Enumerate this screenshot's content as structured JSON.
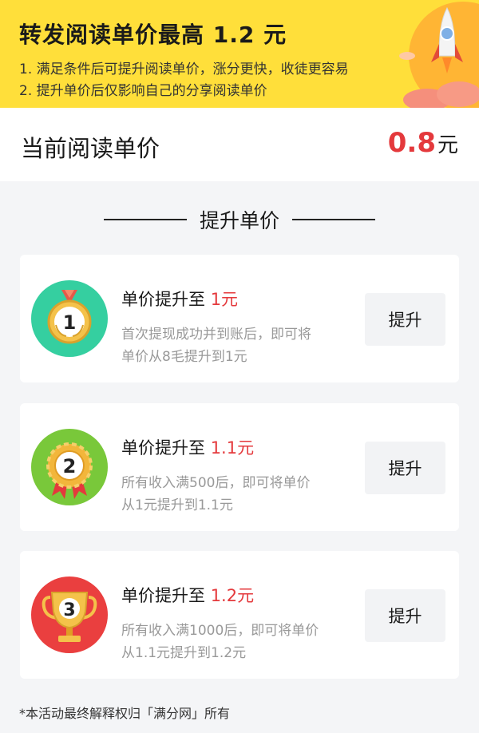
{
  "banner": {
    "title": "转发阅读单价最高 1.2 元",
    "line1": "1.  满足条件后可提升阅读单价，涨分更快，收徒更容易",
    "line2": "2. 提升单价后仅影响自己的分享阅读单价",
    "art_icon": "rocket-icon"
  },
  "current": {
    "label": "当前阅读单价",
    "value": "0.8",
    "unit": "元"
  },
  "section": {
    "heading": "提升单价"
  },
  "cards": [
    {
      "title_prefix": "单价提升至 ",
      "title_value": "1元",
      "desc_line1": "首次提现成功并到账后，即可将",
      "desc_line2": "单价从8毛提升到1元",
      "medal_number": "1",
      "icon": "gold-medal-icon",
      "button_label": "提升"
    },
    {
      "title_prefix": "单价提升至 ",
      "title_value": "1.1元",
      "desc_line1": "所有收入满500后，即可将单价",
      "desc_line2": "从1元提升到1.1元",
      "medal_number": "2",
      "icon": "rosette-medal-icon",
      "button_label": "提升"
    },
    {
      "title_prefix": "单价提升至 ",
      "title_value": "1.2元",
      "desc_line1": "所有收入满1000后，即可将单价",
      "desc_line2": "从1.1元提升到1.2元",
      "medal_number": "3",
      "icon": "trophy-icon",
      "button_label": "提升"
    }
  ],
  "footer": {
    "note": "*本活动最终解释权归「满分网」所有"
  },
  "colors": {
    "banner_bg": "#ffdf3a",
    "accent_red": "#e4393c",
    "medal1_bg": "#35cfa0",
    "medal2_bg": "#79c83a",
    "medal3_bg": "#ea3f3f"
  }
}
